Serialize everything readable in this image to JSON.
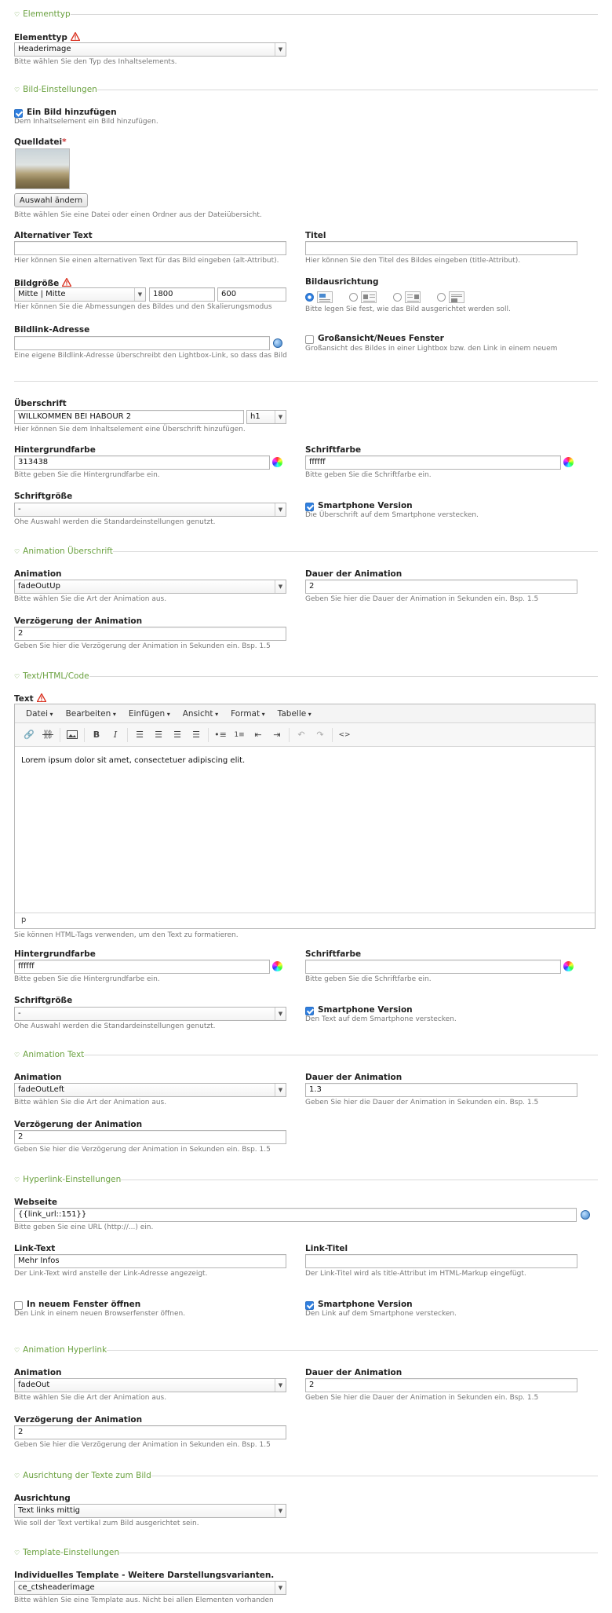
{
  "sections": {
    "elementtyp": "Elementtyp",
    "bild": "Bild-Einstellungen",
    "anim_ueb": "Animation Überschrift",
    "texthtml": "Text/HTML/Code",
    "anim_text": "Animation Text",
    "hyperlink": "Hyperlink-Einstellungen",
    "anim_hyper": "Animation Hyperlink",
    "ausrichtung": "Ausrichtung der Texte zum Bild",
    "template": "Template-Einstellungen"
  },
  "elementtyp": {
    "label": "Elementtyp",
    "value": "Headerimage",
    "hint": "Bitte wählen Sie den Typ des Inhaltselements."
  },
  "bild": {
    "add_label": "Ein Bild hinzufügen",
    "add_hint": "Dem Inhaltselement ein Bild hinzufügen.",
    "quelle_label": "Quelldatei",
    "quelle_star": "*",
    "change_button": "Auswahl ändern",
    "quelle_hint": "Bitte wählen Sie eine Datei oder einen Ordner aus der Dateiübersicht.",
    "alt_label": "Alternativer Text",
    "alt_value": "",
    "alt_hint": "Hier können Sie einen alternativen Text für das Bild eingeben (alt-Attribut).",
    "titel_label": "Titel",
    "titel_value": "",
    "titel_hint": "Hier können Sie den Titel des Bildes eingeben (title-Attribut).",
    "groesse_label": "Bildgröße",
    "groesse_mode": "Mitte | Mitte",
    "groesse_w": "1800",
    "groesse_h": "600",
    "groesse_hint": "Hier können Sie die Abmessungen des Bildes und den Skalierungsmodus",
    "ausr_label": "Bildausrichtung",
    "ausr_hint": "Bitte legen Sie fest, wie das Bild ausgerichtet werden soll.",
    "link_label": "Bildlink-Adresse",
    "link_value": "",
    "link_hint": "Eine eigene Bildlink-Adresse überschreibt den Lightbox-Link, so dass das Bild",
    "gross_label": "Großansicht/Neues Fenster",
    "gross_hint": "Großansicht des Bildes in einer Lightbox bzw. den Link in einem neuem"
  },
  "ueberschrift": {
    "label": "Überschrift",
    "value": "WILLKOMMEN BEI HABOUR 2",
    "tag": "h1",
    "hint": "Hier können Sie dem Inhaltselement eine Überschrift hinzufügen."
  },
  "head_style": {
    "bg_label": "Hintergrundfarbe",
    "bg_value": "313438",
    "bg_hint": "Bitte geben Sie die Hintergrundfarbe ein.",
    "fg_label": "Schriftfarbe",
    "fg_value": "ffffff",
    "fg_hint": "Bitte geben Sie die Schriftfarbe ein.",
    "size_label": "Schriftgröße",
    "size_value": "-",
    "size_hint": "Ohe Auswahl werden die Standardeinstellungen genutzt.",
    "sp_label": "Smartphone Version",
    "sp_hint": "Die Überschrift auf dem Smartphone verstecken."
  },
  "anim1": {
    "anim_label": "Animation",
    "anim_value": "fadeOutUp",
    "anim_hint": "Bitte wählen Sie die Art der Animation aus.",
    "dauer_label": "Dauer der Animation",
    "dauer_value": "2",
    "dauer_hint": "Geben Sie hier die Dauer der Animation in Sekunden ein. Bsp. 1.5",
    "verz_label": "Verzögerung der Animation",
    "verz_value": "2",
    "verz_hint": "Geben Sie hier die Verzögerung der Animation in Sekunden ein. Bsp. 1.5"
  },
  "text": {
    "label": "Text",
    "menu": [
      "Datei",
      "Bearbeiten",
      "Einfügen",
      "Ansicht",
      "Format",
      "Tabelle"
    ],
    "content": "Lorem ipsum dolor sit amet, consectetuer adipiscing elit.",
    "status": "p",
    "hint": "Sie können HTML-Tags verwenden, um den Text zu formatieren."
  },
  "text_style": {
    "bg_label": "Hintergrundfarbe",
    "bg_value": "ffffff",
    "bg_hint": "Bitte geben Sie die Hintergrundfarbe ein.",
    "fg_label": "Schriftfarbe",
    "fg_value": "",
    "fg_hint": "Bitte geben Sie die Schriftfarbe ein.",
    "size_label": "Schriftgröße",
    "size_value": "-",
    "size_hint": "Ohe Auswahl werden die Standardeinstellungen genutzt.",
    "sp_label": "Smartphone Version",
    "sp_hint": "Den Text auf dem Smartphone verstecken."
  },
  "anim2": {
    "anim_label": "Animation",
    "anim_value": "fadeOutLeft",
    "anim_hint": "Bitte wählen Sie die Art der Animation aus.",
    "dauer_label": "Dauer der Animation",
    "dauer_value": "1.3",
    "dauer_hint": "Geben Sie hier die Dauer der Animation in Sekunden ein. Bsp. 1.5",
    "verz_label": "Verzögerung der Animation",
    "verz_value": "2",
    "verz_hint": "Geben Sie hier die Verzögerung der Animation in Sekunden ein. Bsp. 1.5"
  },
  "hyper": {
    "web_label": "Webseite",
    "web_value": "{{link_url::151}}",
    "web_hint": "Bitte geben Sie eine URL (http://...) ein.",
    "lt_label": "Link-Text",
    "lt_value": "Mehr Infos",
    "lt_hint": "Der Link-Text wird anstelle der Link-Adresse angezeigt.",
    "ltitel_label": "Link-Titel",
    "ltitel_value": "",
    "ltitel_hint": "Der Link-Titel wird als title-Attribut im HTML-Markup eingefügt.",
    "nf_label": "In neuem Fenster öffnen",
    "nf_hint": "Den Link in einem neuen Browserfenster öffnen.",
    "sp_label": "Smartphone Version",
    "sp_hint": "Den Link auf dem Smartphone verstecken."
  },
  "anim3": {
    "anim_label": "Animation",
    "anim_value": "fadeOut",
    "anim_hint": "Bitte wählen Sie die Art der Animation aus.",
    "dauer_label": "Dauer der Animation",
    "dauer_value": "2",
    "dauer_hint": "Geben Sie hier die Dauer der Animation in Sekunden ein. Bsp. 1.5",
    "verz_label": "Verzögerung der Animation",
    "verz_value": "2",
    "verz_hint": "Geben Sie hier die Verzögerung der Animation in Sekunden ein. Bsp. 1.5"
  },
  "ausr": {
    "label": "Ausrichtung",
    "value": "Text links mittig",
    "hint": "Wie soll der Text vertikal zum Bild ausgerichtet sein."
  },
  "tpl": {
    "label": "Individuelles Template - Weitere Darstellungsvarianten.",
    "value": "ce_ctsheaderimage",
    "hint": "Bitte wählen Sie eine Template aus. Nicht bei allen Elementen vorhanden"
  },
  "colors": {
    "accent": "#6aa13f",
    "checkbox": "#2f7fe0",
    "warning": "#d9301f"
  }
}
